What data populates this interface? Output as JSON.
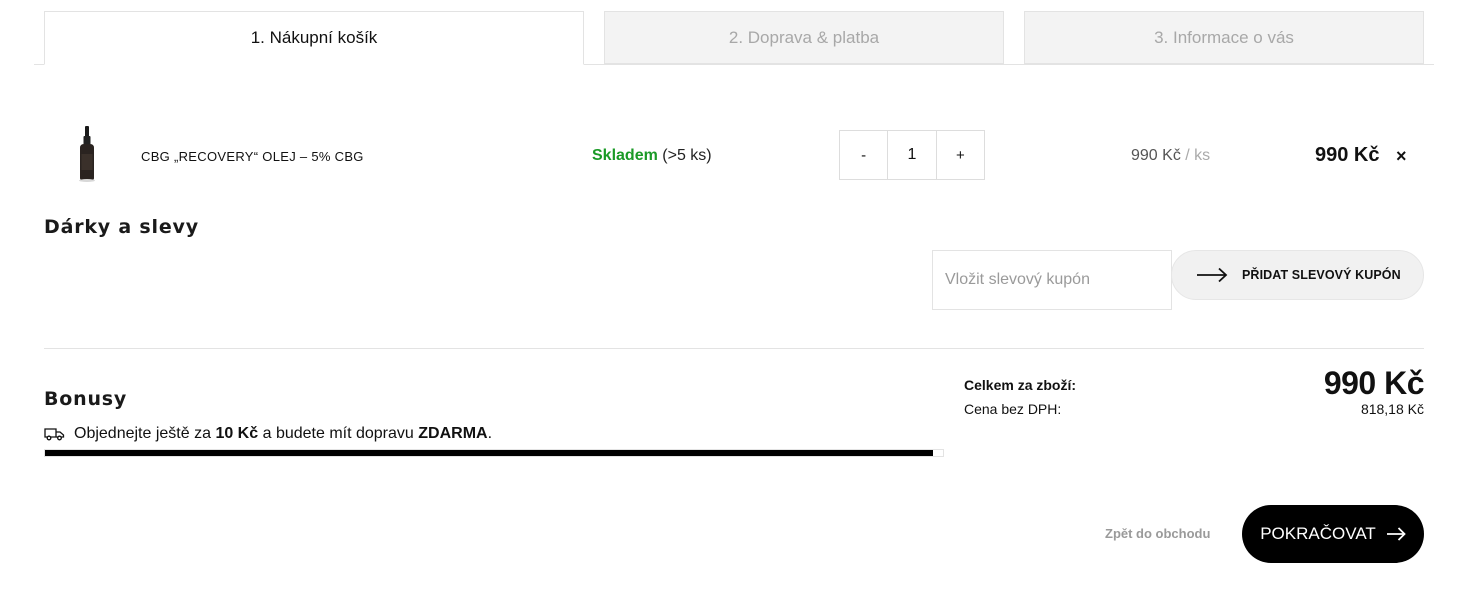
{
  "tabs": [
    {
      "label": "1. Nákupní košík",
      "active": true
    },
    {
      "label": "2. Doprava & platba",
      "active": false
    },
    {
      "label": "3. Informace o vás",
      "active": false
    }
  ],
  "cart": {
    "items": [
      {
        "name": "CBG „RECOVERY“ OLEJ – 5% CBG",
        "stock_status": "Skladem",
        "stock_detail": "(>5 ks)",
        "qty_minus": "-",
        "qty": "1",
        "qty_plus": "+",
        "unit_price": "990 Kč",
        "unit_suffix": "/ ks",
        "total": "990 Kč",
        "remove": "×"
      }
    ]
  },
  "gifts": {
    "heading": "Dárky a slevy",
    "coupon_placeholder": "Vložit slevový kupón",
    "coupon_button": "PŘIDAT SLEVOVÝ KUPÓN"
  },
  "bonus": {
    "heading": "Bonusy",
    "free_shipping": {
      "prefix": "Objednejte ještě za",
      "amount": "10 Kč",
      "middle": "a budete mít dopravu",
      "emphasis": "ZDARMA",
      "suffix": "."
    },
    "progress": 0.989
  },
  "totals": {
    "label": "Celkem za zboží:",
    "value": "990 Kč",
    "no_vat_label": "Cena bez DPH:",
    "no_vat_value": "818,18 Kč"
  },
  "actions": {
    "back": "Zpět do obchodu",
    "continue": "POKRAČOVAT"
  },
  "colors": {
    "in_stock": "#1a9a26",
    "primary_button": "#000000",
    "inactive_tab_bg": "#f3f3f3"
  }
}
